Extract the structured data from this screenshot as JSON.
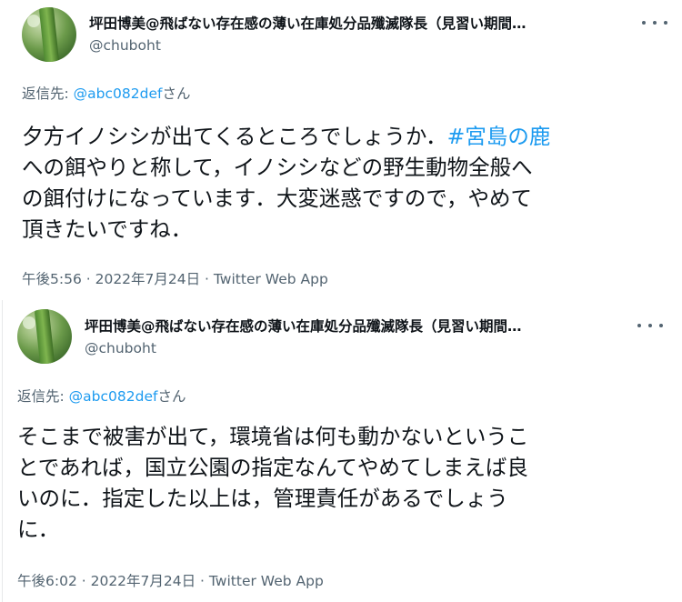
{
  "tweets": [
    {
      "author_name": "坪田博美@飛ばない存在感の薄い在庫処分品殲滅隊長（見習い期間…",
      "author_handle": "@chuboht",
      "reply_prefix": "返信先: ",
      "reply_mention": "@abc082def",
      "reply_suffix": "さん",
      "lines": [
        {
          "text": "夕方イノシシが出てくるところでしょうか．",
          "hashtag": "#宮島の鹿"
        },
        {
          "text": "への餌やりと称して，イノシシなどの野生動物全般へ"
        },
        {
          "text": "の餌付けになっています．大変迷惑ですので，やめて"
        },
        {
          "text": "頂きたいですね．"
        }
      ],
      "time": "午後5:56",
      "separator": " · ",
      "date": "2022年7月24日",
      "source": "Twitter Web App"
    },
    {
      "author_name": "坪田博美@飛ばない存在感の薄い在庫処分品殲滅隊長（見習い期間…",
      "author_handle": "@chuboht",
      "reply_prefix": "返信先: ",
      "reply_mention": "@abc082def",
      "reply_suffix": "さん",
      "lines": [
        {
          "text": "そこまで被害が出て，環境省は何も動かないというこ"
        },
        {
          "text": "とであれば，国立公園の指定なんてやめてしまえば良"
        },
        {
          "text": "いのに．指定した以上は，管理責任があるでしょう"
        },
        {
          "text": "に．"
        }
      ],
      "time": "午後6:02",
      "separator": " · ",
      "date": "2022年7月24日",
      "source": "Twitter Web App"
    }
  ],
  "icons": {
    "more": "more-horizontal-icon",
    "avatar": "avatar"
  },
  "colors": {
    "link": "#1d9bf0",
    "secondary": "#536471",
    "text": "#0f1419"
  }
}
